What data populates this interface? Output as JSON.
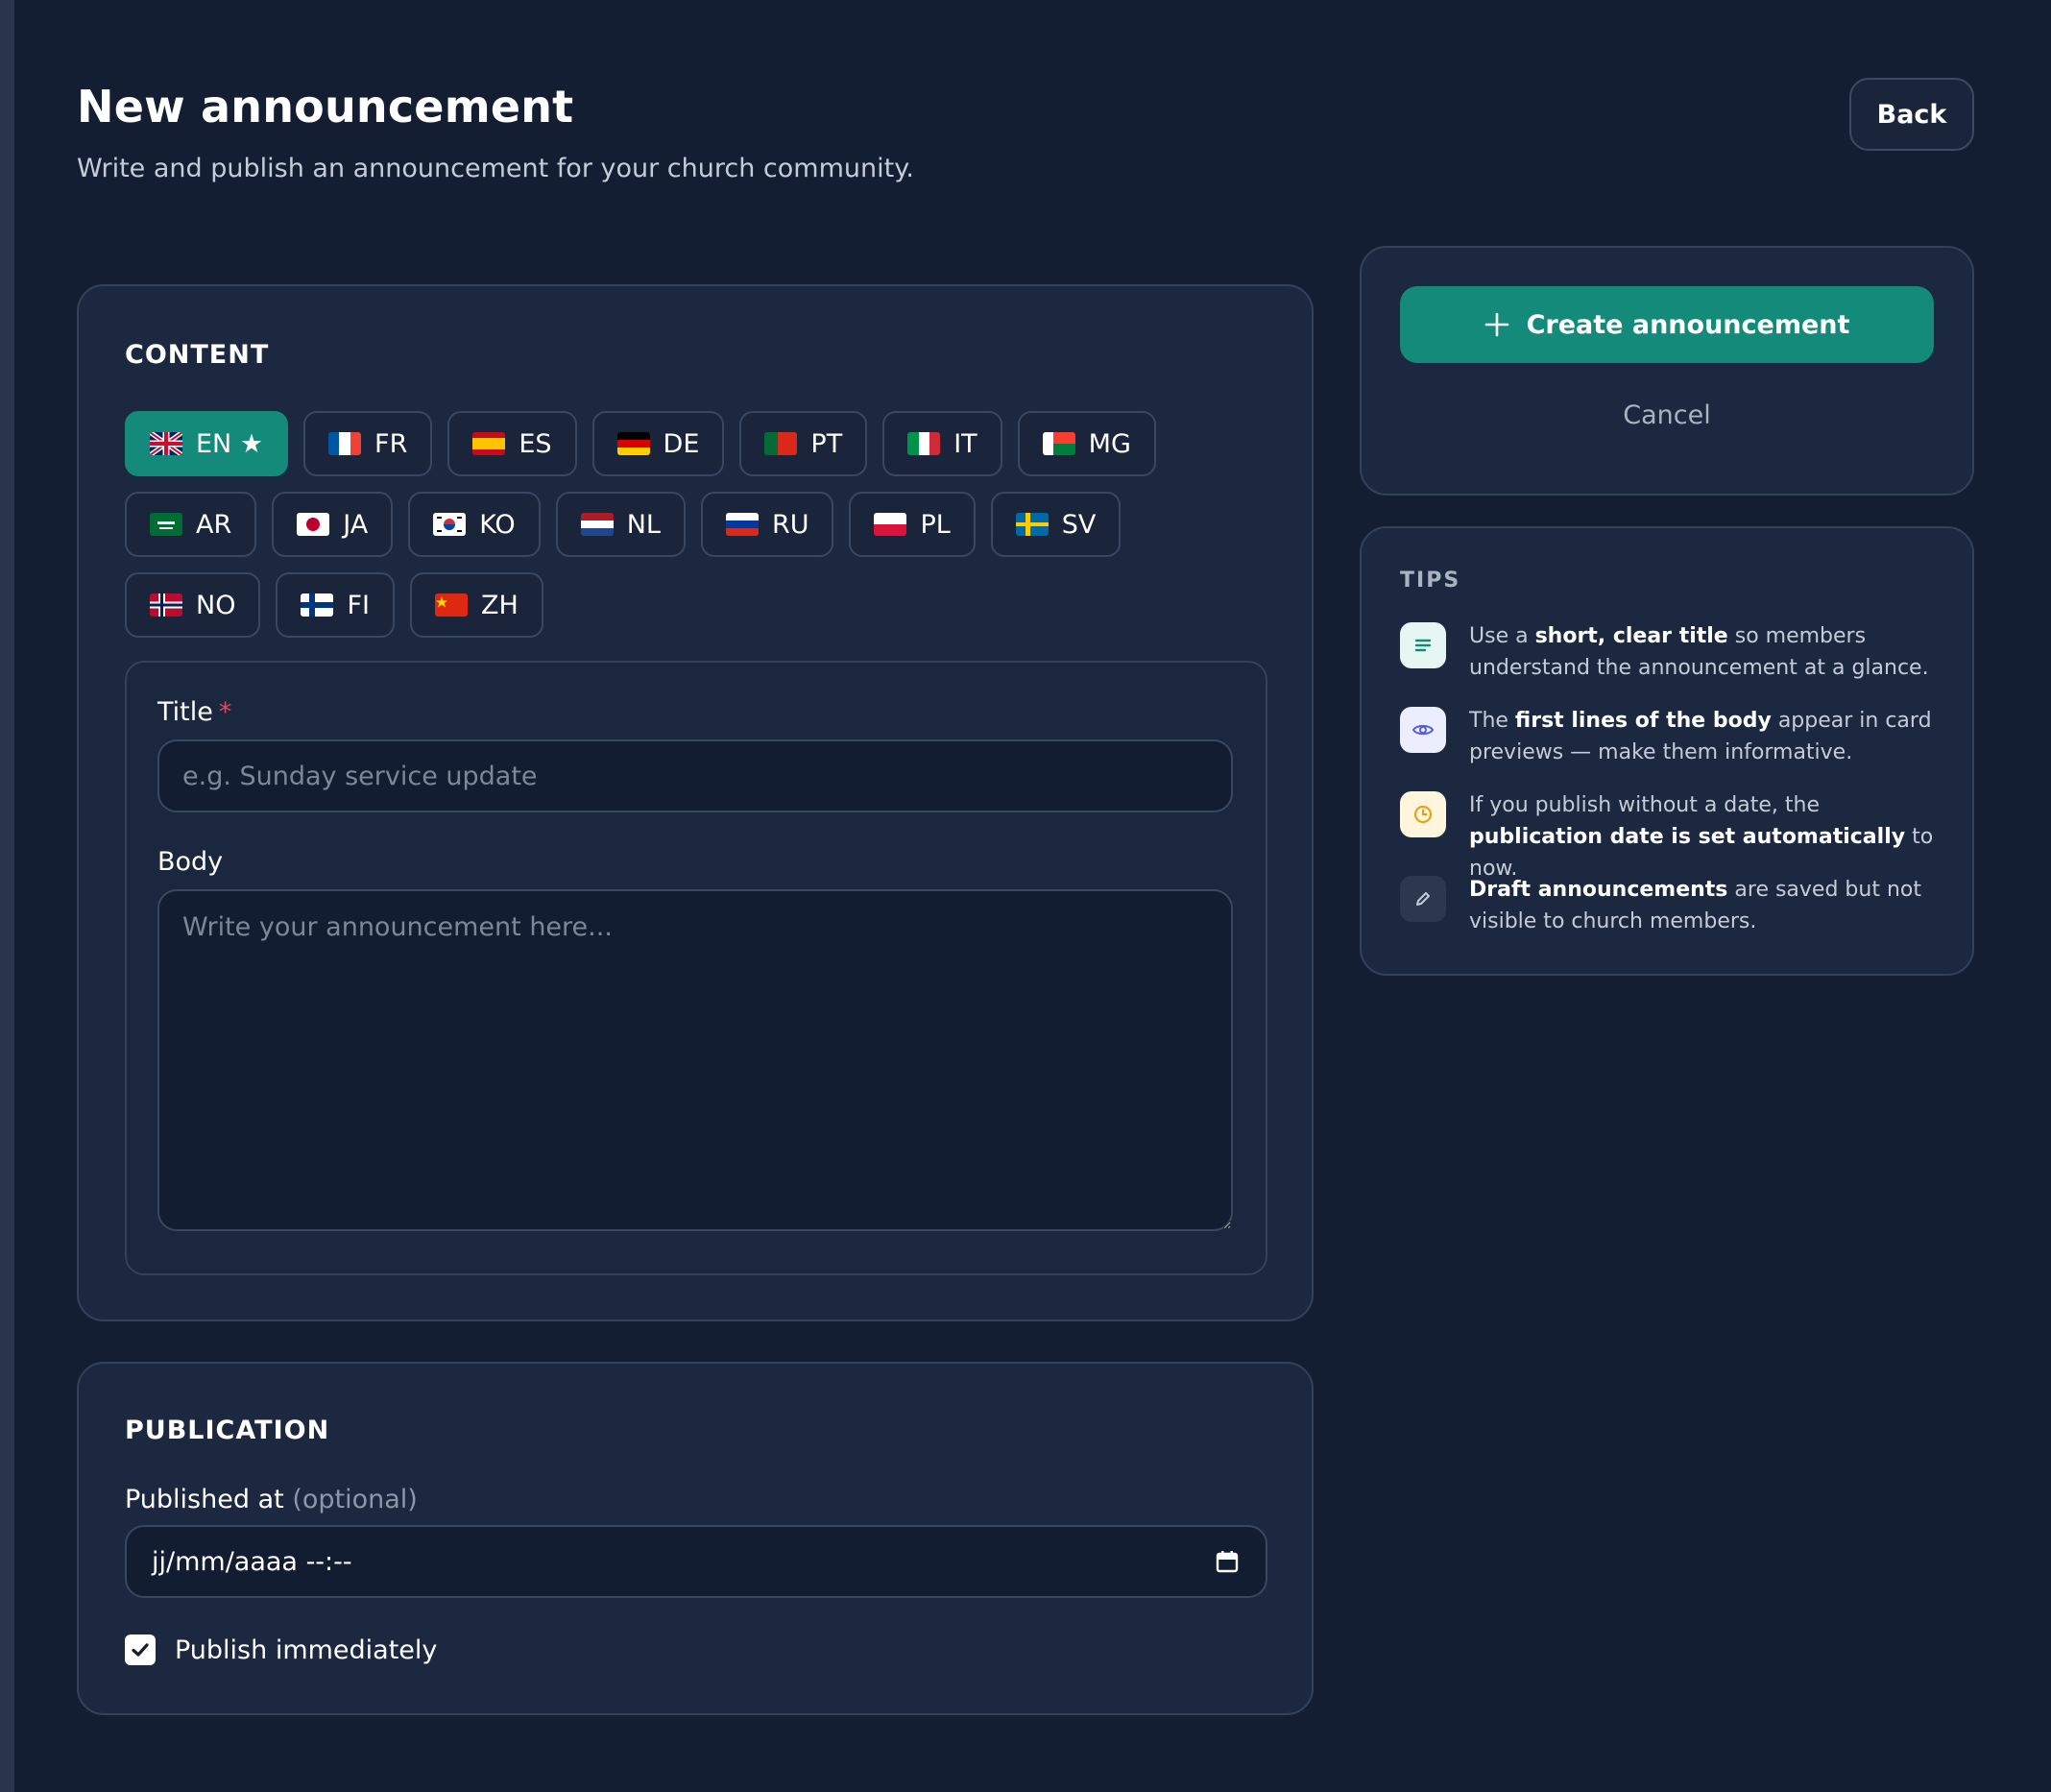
{
  "header": {
    "title": "New announcement",
    "subtitle": "Write and publish an announcement for your church community.",
    "back_label": "Back"
  },
  "content": {
    "heading": "CONTENT",
    "languages": [
      {
        "code": "EN ★",
        "active": true
      },
      {
        "code": "FR"
      },
      {
        "code": "ES"
      },
      {
        "code": "DE"
      },
      {
        "code": "PT"
      },
      {
        "code": "IT"
      },
      {
        "code": "MG"
      },
      {
        "code": "AR"
      },
      {
        "code": "JA"
      },
      {
        "code": "KO"
      },
      {
        "code": "NL"
      },
      {
        "code": "RU"
      },
      {
        "code": "PL"
      },
      {
        "code": "SV"
      },
      {
        "code": "NO"
      },
      {
        "code": "FI"
      },
      {
        "code": "ZH"
      }
    ],
    "title_label": "Title",
    "title_required": "*",
    "title_value": "",
    "title_placeholder": "e.g. Sunday service update",
    "body_label": "Body",
    "body_value": "",
    "body_placeholder": "Write your announcement here..."
  },
  "publication": {
    "heading": "PUBLICATION",
    "published_at_label": "Published at",
    "published_at_optional": "(optional)",
    "date_placeholder": "jj/mm/aaaa --:--",
    "publish_immediately_label": "Publish immediately",
    "publish_immediately_checked": true
  },
  "actions": {
    "create_label": "Create announcement",
    "cancel_label": "Cancel"
  },
  "tips": {
    "heading": "TIPS",
    "items": [
      {
        "icon": "lines-icon",
        "pre": "Use a ",
        "bold": "short, clear title",
        "post": " so members understand the announcement at a glance."
      },
      {
        "icon": "eye-icon",
        "pre": "The ",
        "bold": "first lines of the body",
        "post": " appear in card previews — make them informative."
      },
      {
        "icon": "clock-icon",
        "pre": "If you publish without a date, the ",
        "bold": "publication date is set automatically",
        "post": " to now."
      },
      {
        "icon": "pencil-icon",
        "pre": "",
        "bold": "Draft announcements",
        "post": " are saved but not visible to church members."
      }
    ]
  },
  "colors": {
    "background": "#131e33",
    "card": "#1c2840",
    "accent": "#148a7a",
    "required": "#e5485f"
  }
}
